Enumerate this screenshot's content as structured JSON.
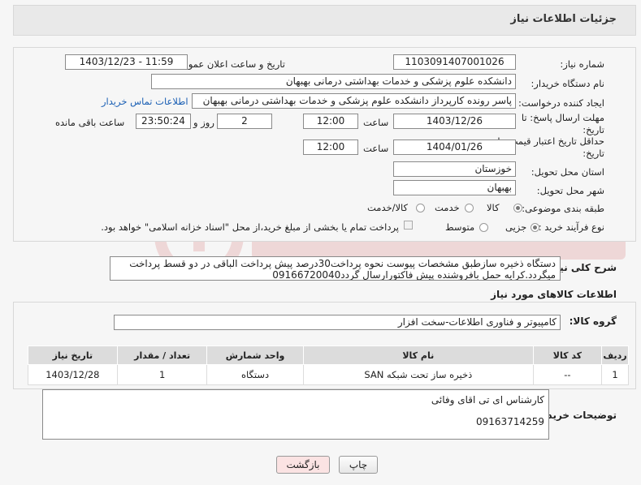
{
  "header": {
    "title": "جزئیات اطلاعات نیاز"
  },
  "form": {
    "need_number_label": "شماره نیاز:",
    "need_number": "1103091407001026",
    "announce_label": "تاریخ و ساعت اعلان عمومی:",
    "announce_value": "1403/12/23 - 11:59",
    "buyer_org_label": "نام دستگاه خریدار:",
    "buyer_org": "دانشکده علوم پزشکی و خدمات بهداشتی  درمانی بهبهان",
    "creator_label": "ایجاد کننده درخواست:",
    "creator": "پاسر رونده کارپرداز دانشکده علوم پزشکی و خدمات بهداشتی  درمانی بهبهان",
    "contact_link": "اطلاعات تماس خریدار",
    "deadline_label_1": "مهلت ارسال پاسخ: تا",
    "deadline_label_2": "تاریخ:",
    "deadline_date": "1403/12/26",
    "time_label": "ساعت",
    "deadline_time": "12:00",
    "days_value": "2",
    "days_label": "روز و",
    "remaining_value": "23:50:24",
    "remaining_label": "ساعت باقی مانده",
    "min_price_label_1": "حداقل تاریخ اعتبار قیمت: تا",
    "min_price_label_2": "تاریخ:",
    "min_price_date": "1404/01/26",
    "min_price_time": "12:00",
    "province_label": "استان محل تحویل:",
    "province": "خوزستان",
    "city_label": "شهر محل تحویل:",
    "city": "بهبهان",
    "category_label": "طبقه بندی موضوعی:",
    "category_options": [
      "کالا",
      "خدمت",
      "کالا/خدمت"
    ],
    "process_label": "نوع فرآیند خرید :",
    "process_options": [
      "جزیی",
      "متوسط"
    ],
    "payment_note": "پرداخت تمام یا بخشی از مبلغ خرید،از محل \"اسناد خزانه اسلامی\" خواهد بود."
  },
  "description": {
    "label": "شرح کلی نیاز:",
    "text": "دستگاه ذخیره سازطبق مشخصات پیوست نحوه پرداخت30درصد پیش پرداخت الباقی در دو قسط پرداخت میگردد.کرایه حمل بافروشنده پیش فاکتورارسال گردد09166720040"
  },
  "goods": {
    "section_title": "اطلاعات کالاهای مورد نیاز",
    "group_label": "گروه کالا:",
    "group_value": "کامپیوتر و فناوری اطلاعات-سخت افزار",
    "columns": [
      "ردیف",
      "کد کالا",
      "نام کالا",
      "واحد شمارش",
      "تعداد / مقدار",
      "تاریخ نیاز"
    ],
    "rows": [
      [
        "1",
        "--",
        "ذخیره ساز تحت شبکه SAN",
        "دستگاه",
        "1",
        "1403/12/28"
      ]
    ]
  },
  "buyer_notes": {
    "label": "توضیحات خریدار:",
    "line1": "کارشناس ای تی اقای وفائی",
    "line2": "09163714259"
  },
  "buttons": {
    "print": "چاپ",
    "back": "بازگشت"
  },
  "colors": {
    "link": "#1a5fb4",
    "back_button_bg": "#fbe3e3"
  }
}
